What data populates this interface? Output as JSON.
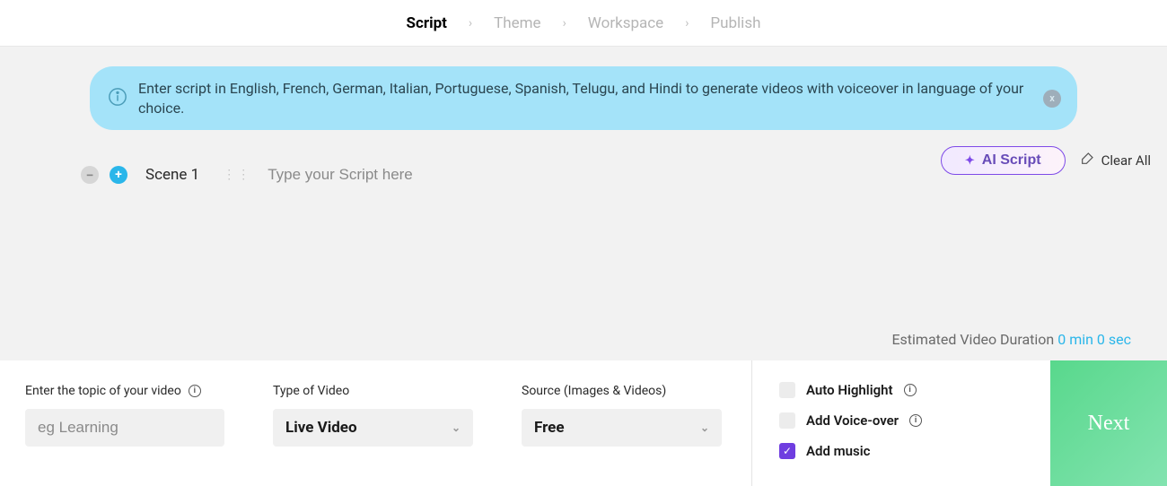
{
  "breadcrumb": {
    "items": [
      {
        "label": "Script",
        "active": true
      },
      {
        "label": "Theme",
        "active": false
      },
      {
        "label": "Workspace",
        "active": false
      },
      {
        "label": "Publish",
        "active": false
      }
    ]
  },
  "banner": {
    "text": "Enter script in English, French, German, Italian, Portuguese, Spanish, Telugu, and Hindi to generate videos with voiceover in language of your choice.",
    "close_label": "x"
  },
  "toolbar": {
    "ai_script_label": "AI Script",
    "clear_all_label": "Clear All"
  },
  "scene": {
    "label": "Scene 1",
    "script_placeholder": "Type your Script here"
  },
  "duration": {
    "prefix": "Estimated Video Duration ",
    "value": "0 min 0 sec"
  },
  "form": {
    "topic": {
      "label": "Enter the topic of your video",
      "placeholder": "eg Learning"
    },
    "video_type": {
      "label": "Type of Video",
      "value": "Live Video"
    },
    "source": {
      "label": "Source (Images & Videos)",
      "value": "Free"
    }
  },
  "options": {
    "auto_highlight": {
      "label": "Auto Highlight",
      "checked": false
    },
    "voice_over": {
      "label": "Add Voice-over",
      "checked": false
    },
    "music": {
      "label": "Add music",
      "checked": true
    }
  },
  "next_label": "Next"
}
